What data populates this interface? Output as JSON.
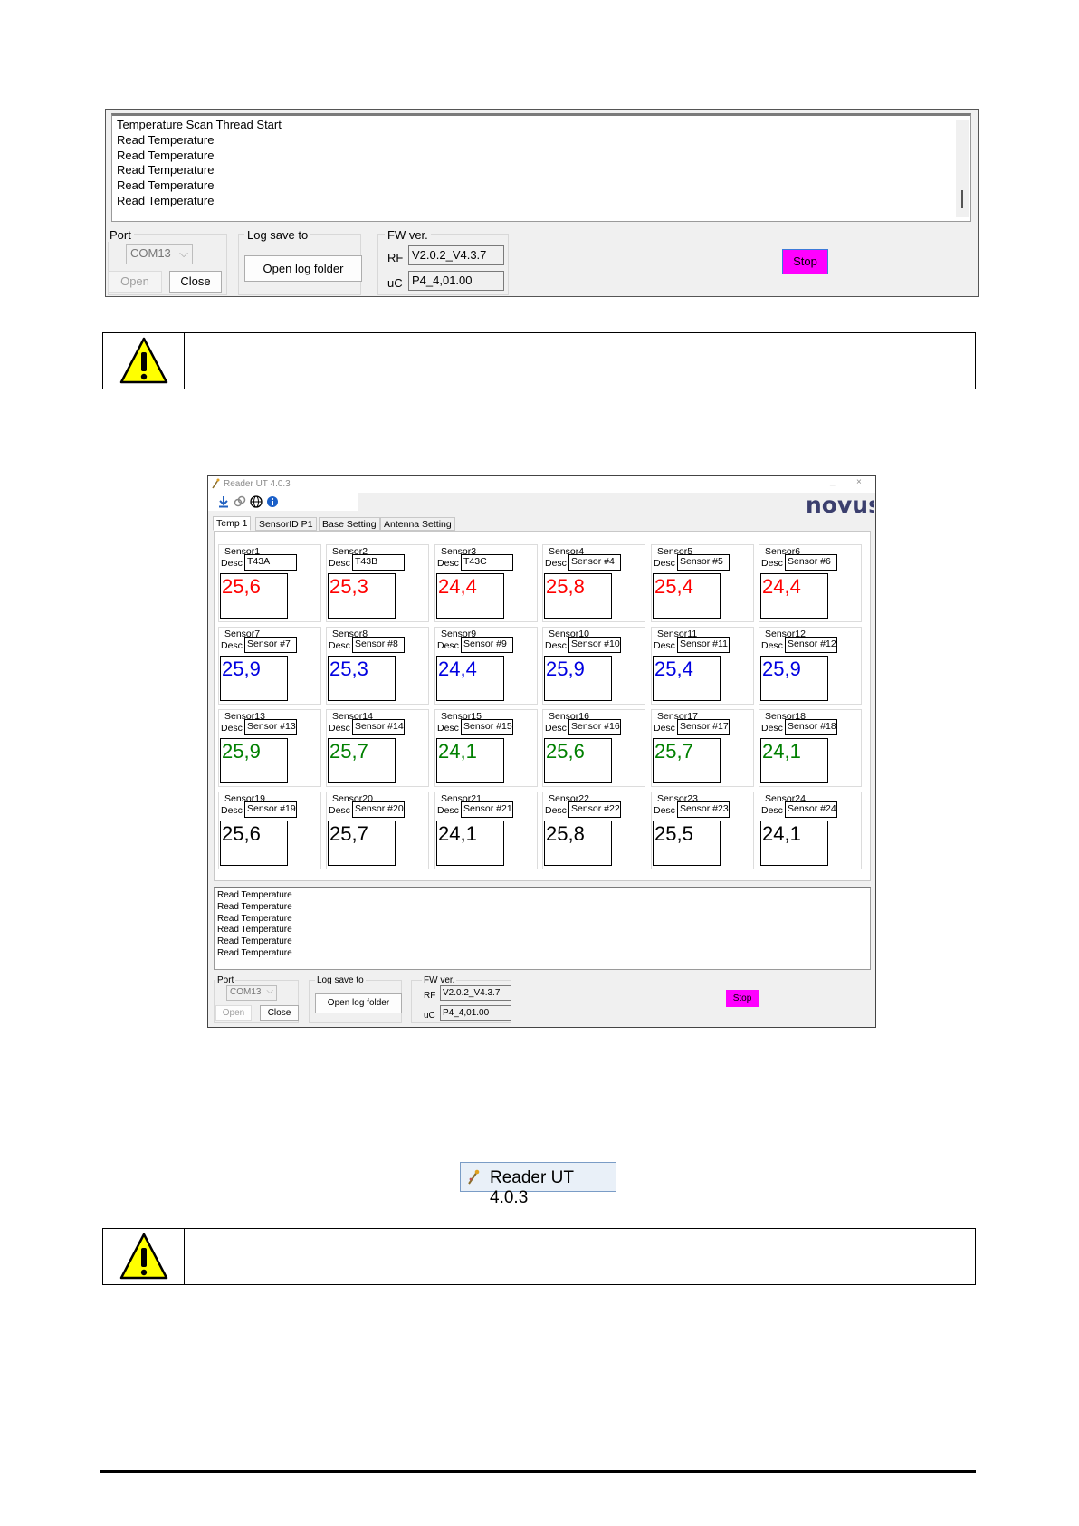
{
  "top_panel": {
    "log_lines": [
      "Temperature Scan Thread Start",
      "Read Temperature",
      "Read Temperature",
      "Read Temperature",
      "Read Temperature",
      "Read Temperature"
    ],
    "port_group": "Port",
    "port_value": "COM13",
    "open_label": "Open",
    "close_label": "Close",
    "log_group": "Log save to",
    "open_log_folder": "Open log folder",
    "fw_group": "FW ver.",
    "rf_label": "RF",
    "rf_value": "V2.0.2_V4.3.7",
    "uc_label": "uC",
    "uc_value": "P4_4,01.00",
    "stop_label": "Stop"
  },
  "colors": {
    "red": "#ff0000",
    "blue": "#0000e0",
    "green": "#008000",
    "black": "#000000",
    "stop": "#ff00ff",
    "warning_yellow": "#ffff00"
  },
  "icons": [
    "warning-triangle-icon",
    "download-icon",
    "link-icon",
    "globe-icon",
    "info-icon",
    "app-icon"
  ],
  "app": {
    "title": "Reader UT 4.0.3",
    "minimize": "_",
    "close": "×",
    "brand": "novus",
    "tabs": [
      "Temp 1",
      "SensorID P1",
      "Base Setting",
      "Antenna Setting"
    ],
    "active_tab": 0,
    "desc_label": "Desc",
    "sensors": [
      {
        "name": "Sensor1",
        "desc": "T43A",
        "value": "25,6",
        "color": "red"
      },
      {
        "name": "Sensor2",
        "desc": "T43B",
        "value": "25,3",
        "color": "red"
      },
      {
        "name": "Sensor3",
        "desc": "T43C",
        "value": "24,4",
        "color": "red"
      },
      {
        "name": "Sensor4",
        "desc": "Sensor #4",
        "value": "25,8",
        "color": "red"
      },
      {
        "name": "Sensor5",
        "desc": "Sensor #5",
        "value": "25,4",
        "color": "red"
      },
      {
        "name": "Sensor6",
        "desc": "Sensor #6",
        "value": "24,4",
        "color": "red"
      },
      {
        "name": "Sensor7",
        "desc": "Sensor #7",
        "value": "25,9",
        "color": "blue"
      },
      {
        "name": "Sensor8",
        "desc": "Sensor #8",
        "value": "25,3",
        "color": "blue"
      },
      {
        "name": "Sensor9",
        "desc": "Sensor #9",
        "value": "24,4",
        "color": "blue"
      },
      {
        "name": "Sensor10",
        "desc": "Sensor #10",
        "value": "25,9",
        "color": "blue"
      },
      {
        "name": "Sensor11",
        "desc": "Sensor #11",
        "value": "25,4",
        "color": "blue"
      },
      {
        "name": "Sensor12",
        "desc": "Sensor #12",
        "value": "25,9",
        "color": "blue"
      },
      {
        "name": "Sensor13",
        "desc": "Sensor #13",
        "value": "25,9",
        "color": "green"
      },
      {
        "name": "Sensor14",
        "desc": "Sensor #14",
        "value": "25,7",
        "color": "green"
      },
      {
        "name": "Sensor15",
        "desc": "Sensor #15",
        "value": "24,1",
        "color": "green"
      },
      {
        "name": "Sensor16",
        "desc": "Sensor #16",
        "value": "25,6",
        "color": "green"
      },
      {
        "name": "Sensor17",
        "desc": "Sensor #17",
        "value": "25,7",
        "color": "green"
      },
      {
        "name": "Sensor18",
        "desc": "Sensor #18",
        "value": "24,1",
        "color": "green"
      },
      {
        "name": "Sensor19",
        "desc": "Sensor #19",
        "value": "25,6",
        "color": "black"
      },
      {
        "name": "Sensor20",
        "desc": "Sensor #20",
        "value": "25,7",
        "color": "black"
      },
      {
        "name": "Sensor21",
        "desc": "Sensor #21",
        "value": "24,1",
        "color": "black"
      },
      {
        "name": "Sensor22",
        "desc": "Sensor #22",
        "value": "25,8",
        "color": "black"
      },
      {
        "name": "Sensor23",
        "desc": "Sensor #23",
        "value": "25,5",
        "color": "black"
      },
      {
        "name": "Sensor24",
        "desc": "Sensor #24",
        "value": "24,1",
        "color": "black"
      }
    ],
    "log_lines": [
      "Read Temperature",
      "Read Temperature",
      "Read Temperature",
      "Read Temperature",
      "Read Temperature",
      "Read Temperature"
    ],
    "port_group": "Port",
    "port_value": "COM13",
    "open_label": "Open",
    "close_label": "Close",
    "log_group": "Log save to",
    "open_log_folder": "Open log folder",
    "fw_group": "FW ver.",
    "rf_label": "RF",
    "rf_value": "V2.0.2_V4.3.7",
    "uc_label": "uC",
    "uc_value": "P4_4,01.00",
    "stop_label": "Stop"
  },
  "title_badge": {
    "label": "Reader UT 4.0.3"
  }
}
